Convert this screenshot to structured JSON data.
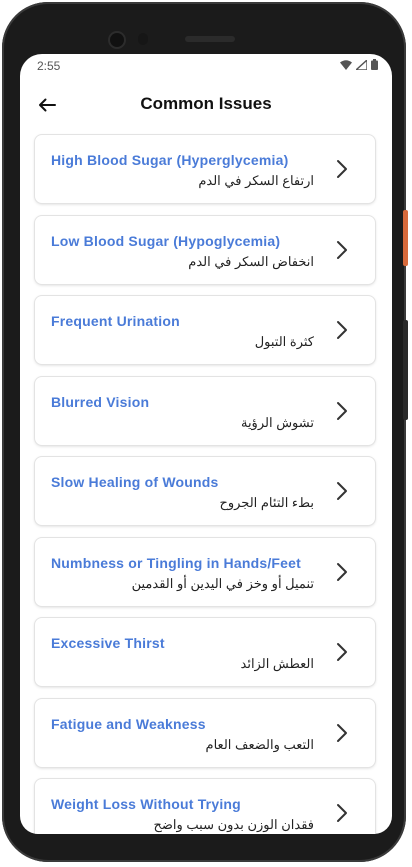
{
  "status_bar": {
    "time": "2:55",
    "icons": [
      "wifi-icon",
      "signal-icon",
      "battery-icon"
    ]
  },
  "header": {
    "title": "Common Issues",
    "back_icon": "arrow-left-icon"
  },
  "colors": {
    "accent": "#4a7bd8",
    "title": "#111111"
  },
  "issues": [
    {
      "title": "High Blood Sugar (Hyperglycemia)",
      "subtitle": "ارتفاع السكر في الدم"
    },
    {
      "title": "Low Blood Sugar (Hypoglycemia)",
      "subtitle": "انخفاض السكر في الدم"
    },
    {
      "title": "Frequent Urination",
      "subtitle": "كثرة التبول"
    },
    {
      "title": "Blurred Vision",
      "subtitle": "تشوش الرؤية"
    },
    {
      "title": "Slow Healing of Wounds",
      "subtitle": "بطء التئام الجروح"
    },
    {
      "title": "Numbness or Tingling in Hands/Feet",
      "subtitle": "تنميل أو وخز في اليدين أو القدمين"
    },
    {
      "title": "Excessive Thirst",
      "subtitle": "العطش الزائد"
    },
    {
      "title": "Fatigue and Weakness",
      "subtitle": "التعب والضعف العام"
    },
    {
      "title": "Weight Loss Without Trying",
      "subtitle": "فقدان الوزن بدون سبب واضح"
    }
  ]
}
